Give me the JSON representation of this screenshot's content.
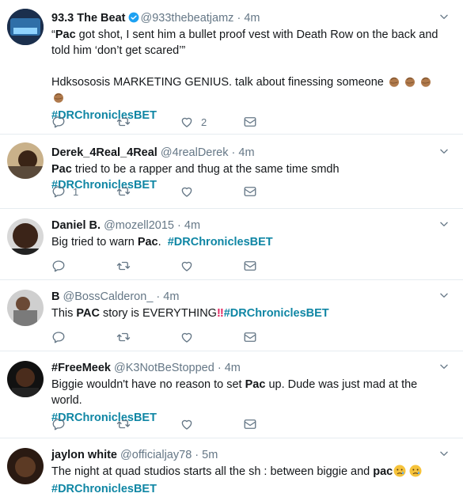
{
  "tweets": [
    {
      "name": "93.3 The Beat",
      "handle": "@933thebeatjamz",
      "time": "4m",
      "verified": true,
      "line1_pre": "“",
      "line1_bold": "Pac",
      "line1_post": " got shot, I sent him a bullet proof vest with Death Row on the back and told him ‘don’t get scared’”",
      "line2": "Hdksososis MARKETING GENIUS. talk about finessing someone",
      "hashtag": "#DRChroniclesBET",
      "reply_count": "",
      "like_count": "2"
    },
    {
      "name": "Derek_4Real_4Real",
      "handle": "@4realDerek",
      "time": "4m",
      "bold": "Pac",
      "text": " tried to be a rapper and thug at the same time smdh",
      "hashtag": "#DRChroniclesBET",
      "reply_count": "1",
      "like_count": ""
    },
    {
      "name": "Daniel B.",
      "handle": "@mozell2015",
      "time": "4m",
      "text": "Big tried to warn ",
      "bold": "Pac",
      "text_post": ".",
      "hashtag": "#DRChroniclesBET"
    },
    {
      "name": "B",
      "handle": "@BossCalderon_",
      "time": "4m",
      "text": "This ",
      "bold": "PAC",
      "text_post": " story is EVERYTHING",
      "bang": "‼",
      "hashtag": "#DRChroniclesBET"
    },
    {
      "name": "#FreeMeek",
      "handle": "@K3NotBeStopped",
      "time": "4m",
      "text": "Biggie wouldn't have no reason to set ",
      "bold": "Pac",
      "text_post": " up. Dude was just mad at the world.",
      "hashtag": "#DRChroniclesBET"
    },
    {
      "name": "jaylon white",
      "handle": "@officialjay78",
      "time": "5m",
      "text": "The night at quad studios starts all the sh : between biggie and ",
      "bold": "pac",
      "hashtag": "#DRChroniclesBET"
    }
  ],
  "colors": {
    "accent": "#1da1f2",
    "hashtag": "#0f86a4",
    "muted": "#657786",
    "divider": "#e6ecf0"
  },
  "icons": [
    "reply-icon",
    "retweet-icon",
    "like-icon",
    "dm-icon",
    "chevron-down-icon",
    "verified-icon",
    "clap-emoji",
    "sad-emoji"
  ]
}
